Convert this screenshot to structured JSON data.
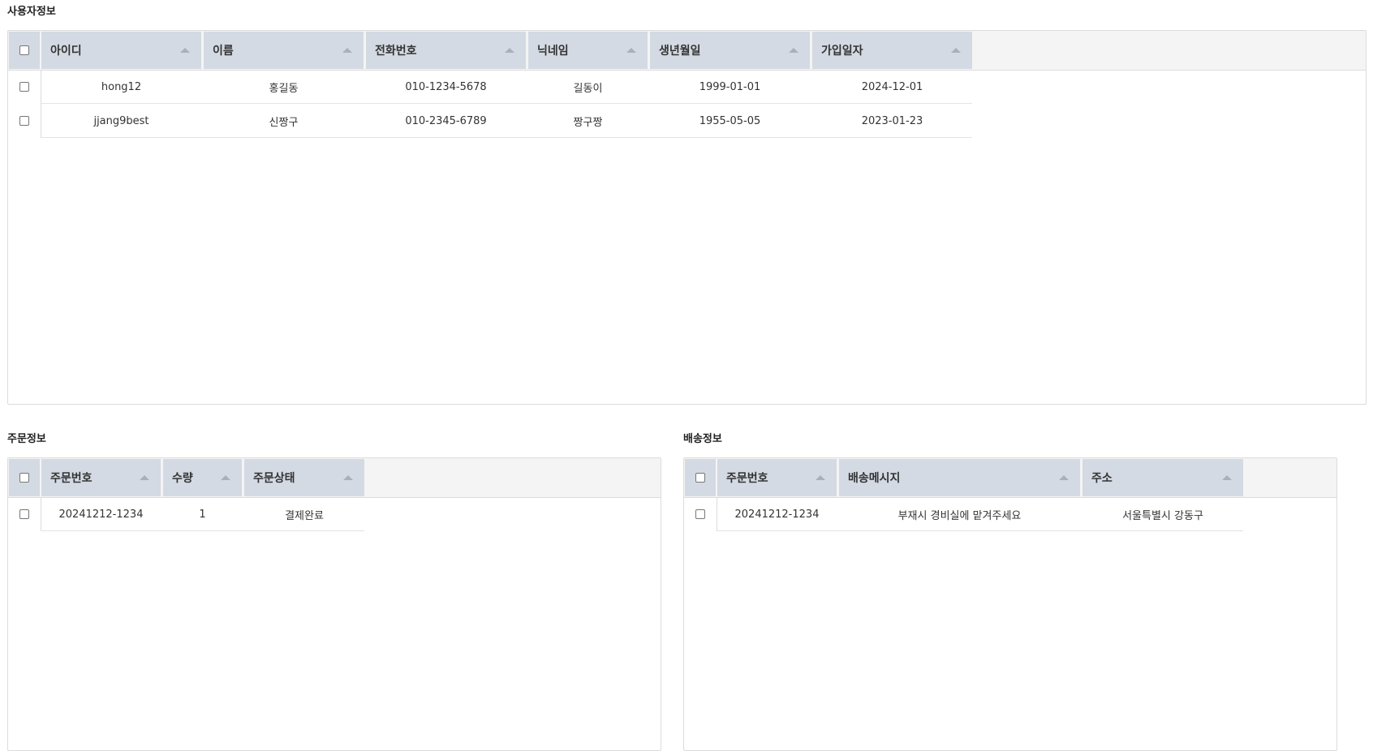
{
  "user_section": {
    "title": "사용자정보",
    "columns": [
      "아이디",
      "이름",
      "전화번호",
      "닉네임",
      "생년월일",
      "가입일자"
    ],
    "rows": [
      [
        "hong12",
        "홍길동",
        "010-1234-5678",
        "길동이",
        "1999-01-01",
        "2024-12-01"
      ],
      [
        "jjang9best",
        "신짱구",
        "010-2345-6789",
        "짱구짱",
        "1955-05-05",
        "2023-01-23"
      ]
    ]
  },
  "order_section": {
    "title": "주문정보",
    "columns": [
      "주문번호",
      "수량",
      "주문상태"
    ],
    "rows": [
      [
        "20241212-1234",
        "1",
        "결제완료"
      ]
    ]
  },
  "delivery_section": {
    "title": "배송정보",
    "columns": [
      "주문번호",
      "배송메시지",
      "주소"
    ],
    "rows": [
      [
        "20241212-1234",
        "부재시 경비실에 맡겨주세요",
        "서울특별시 강동구"
      ]
    ]
  },
  "icons": {
    "sort": "sort-ascending-icon",
    "checkbox": "checkbox-icon"
  },
  "colors": {
    "header_bg": "#d4dae3",
    "sort_icon": "#a9b0ba",
    "border": "#dcdcdc"
  }
}
